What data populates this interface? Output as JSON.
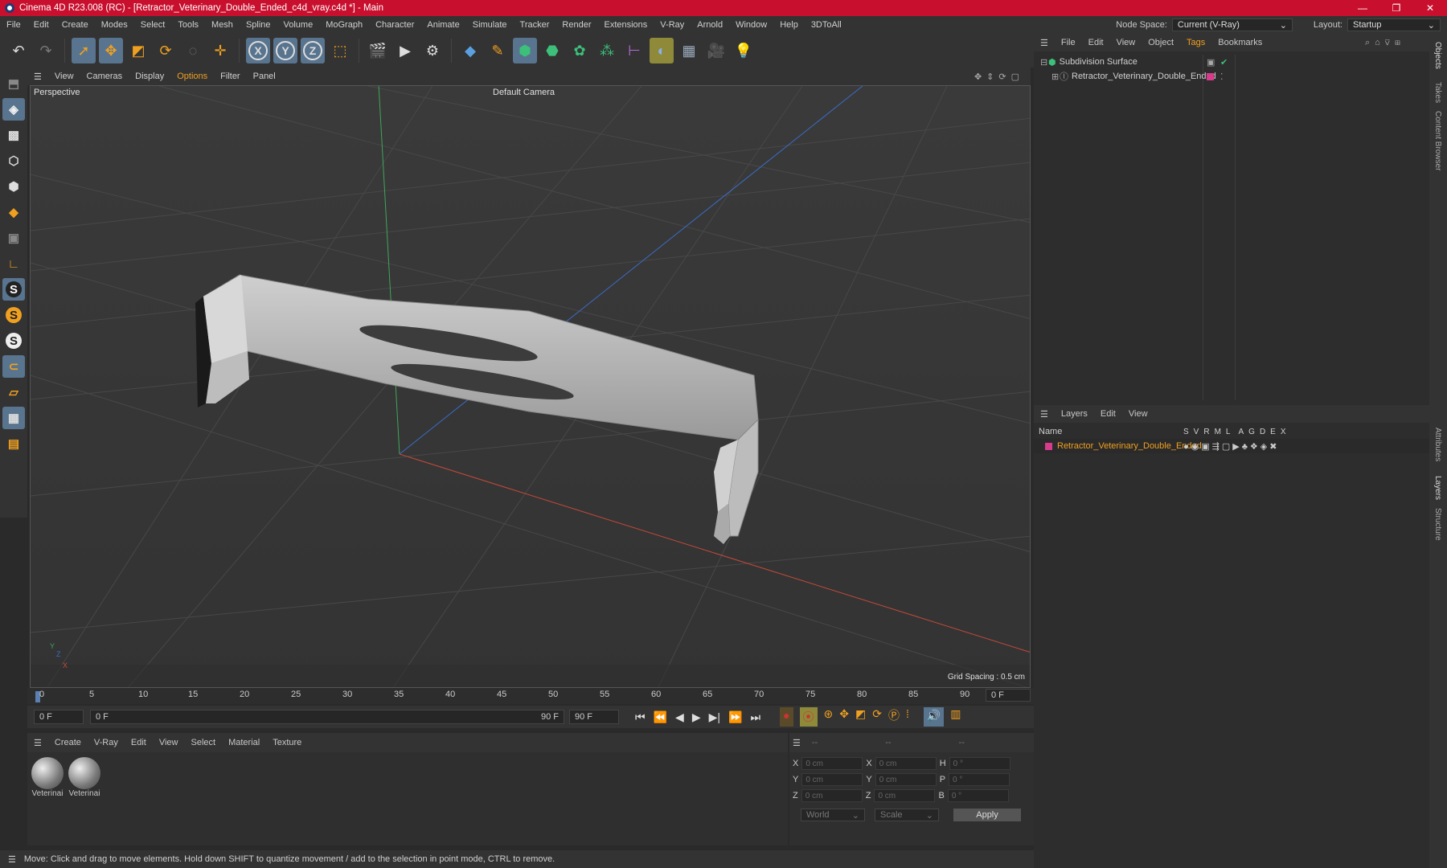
{
  "window": {
    "title": "Cinema 4D R23.008 (RC) - [Retractor_Veterinary_Double_Ended_c4d_vray.c4d *] - Main",
    "controls": [
      "—",
      "❐",
      "✕"
    ]
  },
  "menubar": {
    "items": [
      "File",
      "Edit",
      "Create",
      "Modes",
      "Select",
      "Tools",
      "Mesh",
      "Spline",
      "Volume",
      "MoGraph",
      "Character",
      "Animate",
      "Simulate",
      "Tracker",
      "Render",
      "Extensions",
      "V-Ray",
      "Arnold",
      "Window",
      "Help",
      "3DToAll"
    ],
    "node_space_label": "Node Space:",
    "node_space_value": "Current (V-Ray)",
    "layout_label": "Layout:",
    "layout_value": "Startup"
  },
  "toolbar": {
    "icons": [
      "undo-icon",
      "redo-icon",
      "select-icon",
      "move-icon",
      "scale-icon",
      "rotate-icon",
      "live-select-icon",
      "transform-icon",
      "x-axis-icon",
      "y-axis-icon",
      "z-axis-icon",
      "coord-system-icon",
      "render-region-icon",
      "render-view-icon",
      "render-settings-icon",
      "cube-icon",
      "pen-icon",
      "subdivision-icon",
      "extrude-icon",
      "cloner-icon",
      "instance-icon",
      "measure-icon",
      "deformer-icon",
      "floor-icon",
      "camera-icon",
      "light-icon"
    ]
  },
  "viewport": {
    "menu": [
      "View",
      "Cameras",
      "Display",
      "Options",
      "Filter",
      "Panel"
    ],
    "label": "Perspective",
    "camera": "Default Camera",
    "grid_spacing": "Grid Spacing : 0.5 cm",
    "axis_y": "Y",
    "axis_z": "Z",
    "axis_x": "X"
  },
  "timeline": {
    "ticks": [
      "0",
      "5",
      "10",
      "15",
      "20",
      "25",
      "30",
      "35",
      "40",
      "45",
      "50",
      "55",
      "60",
      "65",
      "70",
      "75",
      "80",
      "85",
      "90"
    ],
    "current_frame": "0 F",
    "start": "0 F",
    "range_start": "0 F",
    "range_end": "90 F",
    "end": "90 F"
  },
  "materials": {
    "menu": [
      "Create",
      "V-Ray",
      "Edit",
      "View",
      "Select",
      "Material",
      "Texture"
    ],
    "items": [
      "Veterinai",
      "Veterinai"
    ]
  },
  "coords": {
    "headers": [
      "--",
      "--",
      "--"
    ],
    "rows": [
      {
        "a": "X",
        "av": "0 cm",
        "b": "X",
        "bv": "0 cm",
        "c": "H",
        "cv": "0 °"
      },
      {
        "a": "Y",
        "av": "0 cm",
        "b": "Y",
        "bv": "0 cm",
        "c": "P",
        "cv": "0 °"
      },
      {
        "a": "Z",
        "av": "0 cm",
        "b": "Z",
        "bv": "0 cm",
        "c": "B",
        "cv": "0 °"
      }
    ],
    "mode1": "World",
    "mode2": "Scale",
    "apply": "Apply"
  },
  "objects": {
    "menu": [
      "File",
      "Edit",
      "View",
      "Object",
      "Tags",
      "Bookmarks"
    ],
    "items": [
      {
        "name": "Subdivision Surface"
      },
      {
        "name": "Retractor_Veterinary_Double_Ended"
      }
    ]
  },
  "layers": {
    "menu": [
      "Layers",
      "Edit",
      "View"
    ],
    "col_name": "Name",
    "cols": [
      "S",
      "V",
      "R",
      "M",
      "L",
      "A",
      "G",
      "D",
      "E",
      "X"
    ],
    "items": [
      {
        "name": "Retractor_Veterinary_Double_Ended",
        "color": "#d63b8c"
      }
    ]
  },
  "sidetabs": [
    "Objects",
    "Takes",
    "Content Browser",
    "Attributes",
    "Layers",
    "Structure"
  ],
  "status": "Move: Click and drag to move elements. Hold down SHIFT to quantize movement / add to the selection in point mode, CTRL to remove.",
  "colors": {
    "accent": "#f0a020",
    "titlebar": "#c8102e",
    "selected": "#58748f"
  }
}
